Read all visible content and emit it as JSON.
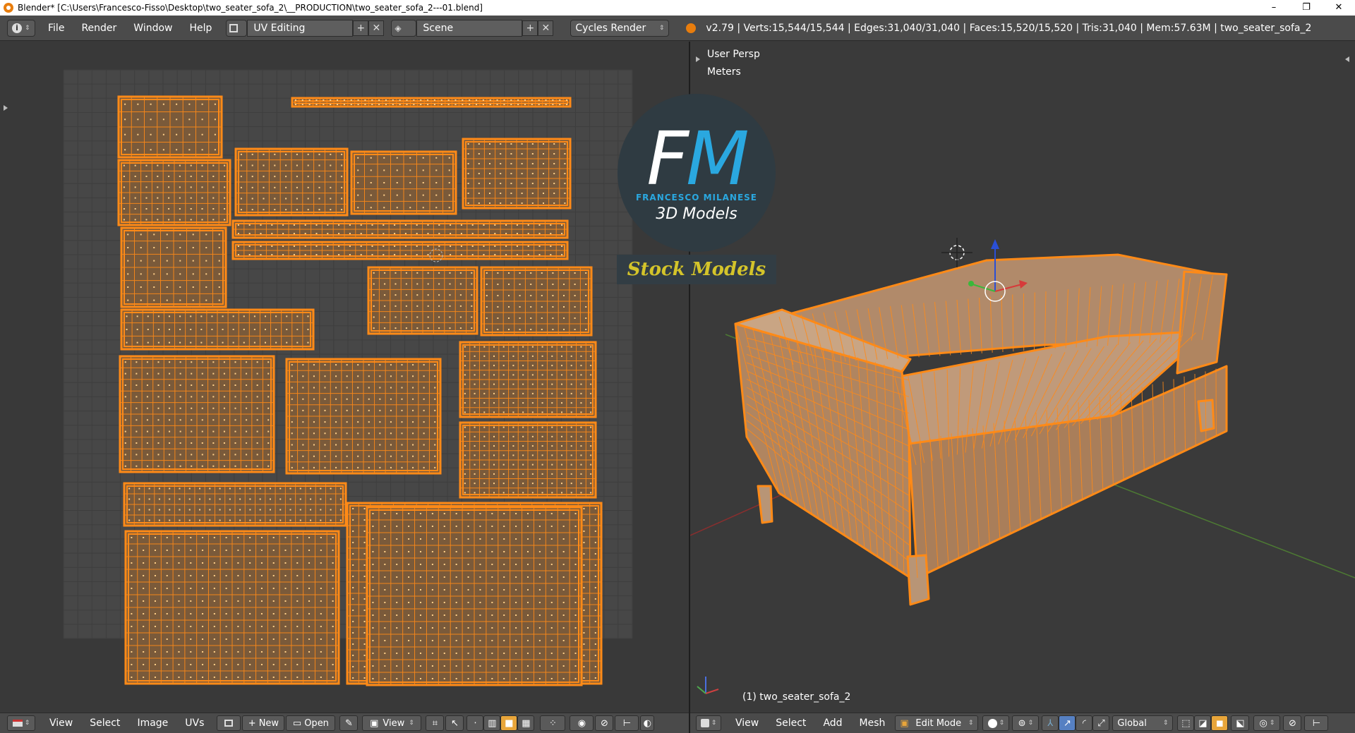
{
  "window": {
    "title": "Blender* [C:\\Users\\Francesco-Fisso\\Desktop\\two_seater_sofa_2\\__PRODUCTION\\two_seater_sofa_2---01.blend]",
    "controls": [
      "–",
      "❐",
      "✕"
    ]
  },
  "infobar": {
    "menus": [
      "File",
      "Render",
      "Window",
      "Help"
    ],
    "screen_layout": "UV Editing",
    "scene": "Scene",
    "render_engine": "Cycles Render",
    "stats": "v2.79 | Verts:15,544/15,544 | Edges:31,040/31,040 | Faces:15,520/15,520 | Tris:31,040 | Mem:57.63M | two_seater_sofa_2"
  },
  "viewport": {
    "view_name": "User Persp",
    "units": "Meters",
    "object_label": "(1) two_seater_sofa_2"
  },
  "watermark": {
    "letters_f": "F",
    "letters_m": "M",
    "brand": "FRANCESCO MILANESE",
    "tagline": "3D Models",
    "banner": "Stock Models"
  },
  "uv_header": {
    "menus": [
      "View",
      "Select",
      "Image",
      "UVs"
    ],
    "new_label": "New",
    "open_label": "Open",
    "view_label": "View"
  },
  "view3d_header": {
    "menus": [
      "View",
      "Select",
      "Add",
      "Mesh"
    ],
    "mode": "Edit Mode",
    "orientation": "Global"
  },
  "colors": {
    "accent": "#ff8a17",
    "island_fill": "#7a5a3a",
    "background": "#393939"
  }
}
